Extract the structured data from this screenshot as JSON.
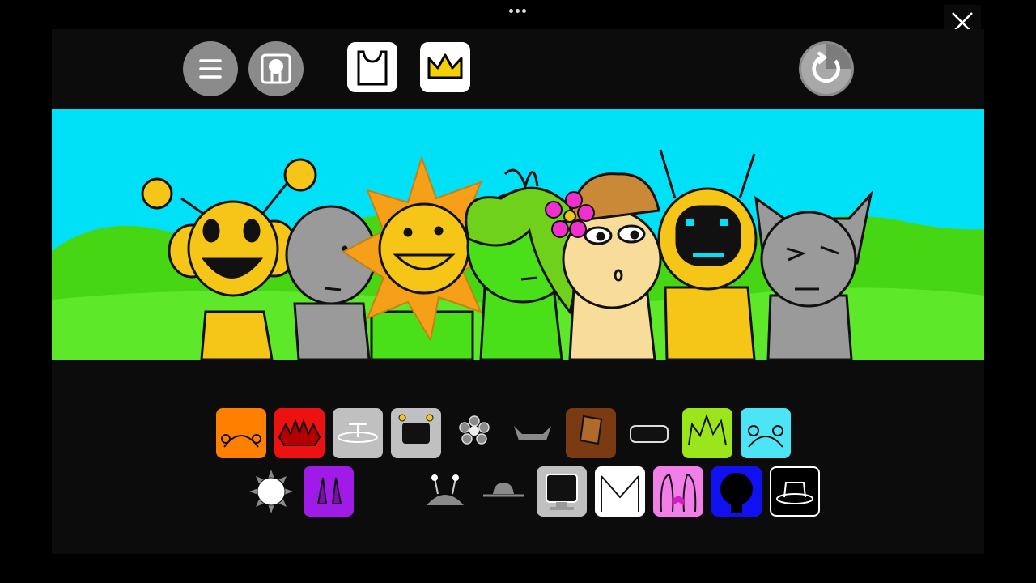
{
  "app": {
    "menu_icon": "menu-icon",
    "profile_icon": "character-profile-icon",
    "close_icon": "close-icon",
    "more_icon": "more-dots-icon",
    "reset_icon": "reset-icon"
  },
  "toolbar": {
    "categories": [
      {
        "icon": "shirt-icon",
        "selected": true
      },
      {
        "icon": "crown-icon",
        "selected": false
      }
    ]
  },
  "scene": {
    "characters": [
      {
        "name": "yellow-antenna-character",
        "color": "#f5c518"
      },
      {
        "name": "gray-character",
        "color": "#9a9a9a"
      },
      {
        "name": "sun-character",
        "color": "#f5c518"
      },
      {
        "name": "green-leaf-character",
        "color": "#49e01a"
      },
      {
        "name": "tan-hat-character",
        "color": "#f8dc9a"
      },
      {
        "name": "yellow-visor-character",
        "color": "#f5c518"
      },
      {
        "name": "gray-cat-character",
        "color": "#9a9a9a"
      }
    ],
    "sky_color": "#00e1f7",
    "grass_color": "#49d81a"
  },
  "palette": {
    "row1": [
      {
        "icon": "orange-antennae-icon",
        "color": "#ff7f00"
      },
      {
        "icon": "red-spikes-icon",
        "color": "#ee1111"
      },
      {
        "icon": "propeller-hat-icon",
        "color": "#c0c0c0"
      },
      {
        "icon": "tv-head-icon",
        "color": "#c0c0c0"
      },
      {
        "icon": "flower-icon",
        "color": "transparent"
      },
      {
        "icon": "horned-helmet-icon",
        "color": "transparent"
      },
      {
        "icon": "bucket-hat-icon",
        "color": "#7b3b12"
      },
      {
        "icon": "visor-icon",
        "color": "transparent"
      },
      {
        "icon": "leaf-hair-icon",
        "color": "#9be61a"
      },
      {
        "icon": "cyan-ears-icon",
        "color": "#4de4f5"
      }
    ],
    "row2": [
      {
        "icon": "sun-rays-icon",
        "color": "transparent"
      },
      {
        "icon": "purple-horns-icon",
        "color": "#a11be8"
      },
      {
        "icon": "empty-slot",
        "color": "transparent"
      },
      {
        "icon": "bug-antennae-icon",
        "color": "transparent"
      },
      {
        "icon": "bowler-hat-icon",
        "color": "transparent"
      },
      {
        "icon": "monitor-icon",
        "color": "#c0c0c0"
      },
      {
        "icon": "envelope-hood-icon",
        "color": "#ffffff"
      },
      {
        "icon": "pink-bow-icon",
        "color": "#f27ee8"
      },
      {
        "icon": "blue-hood-icon",
        "color": "#1010f0"
      },
      {
        "icon": "top-hat-icon",
        "color": "#000000"
      }
    ]
  }
}
